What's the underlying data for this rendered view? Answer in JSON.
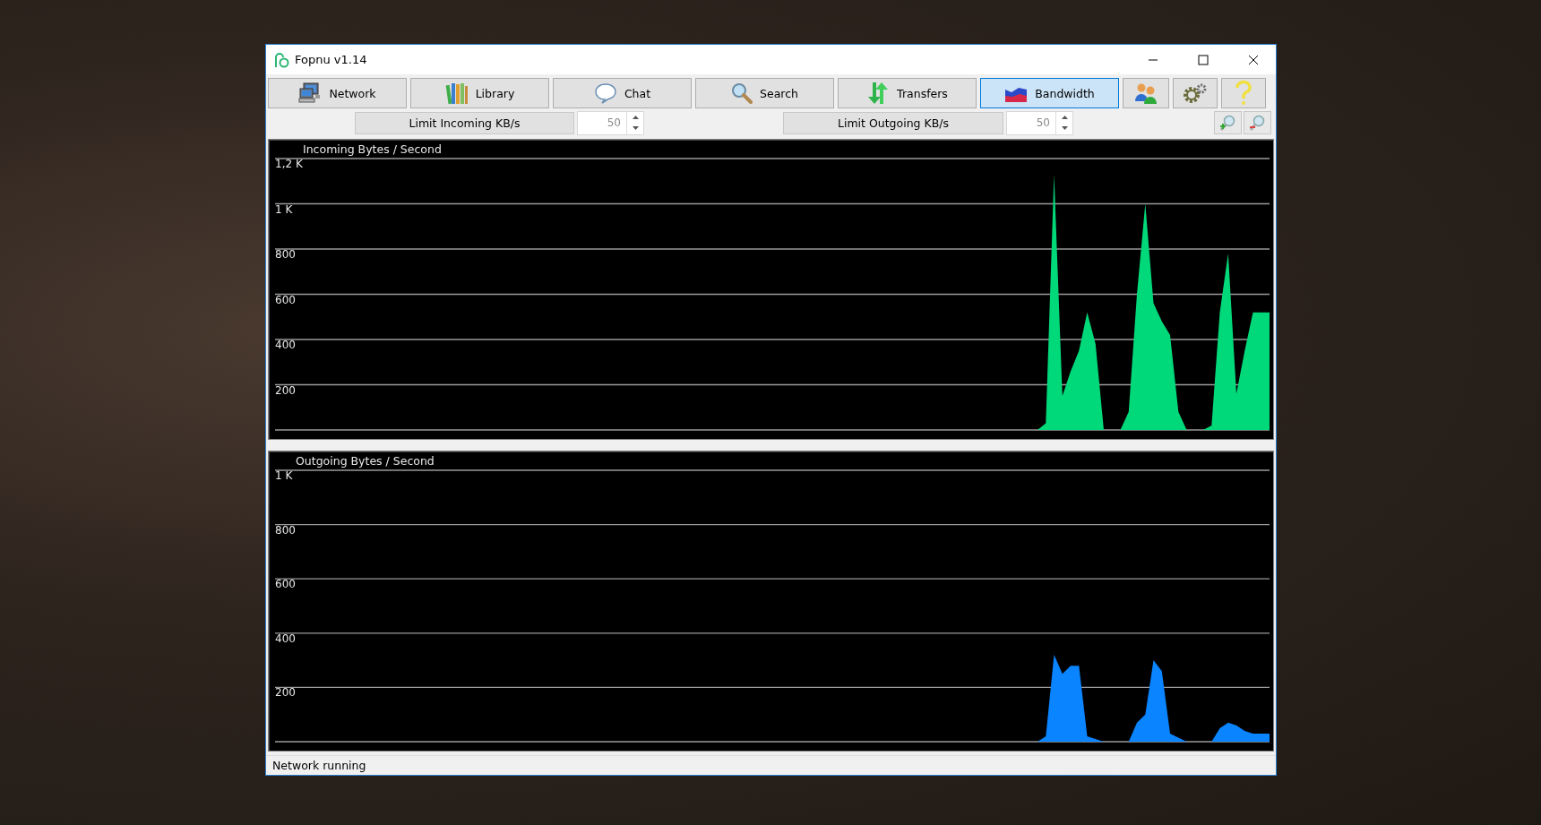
{
  "window": {
    "title": "Fopnu v1.14"
  },
  "toolbar": {
    "tabs": [
      {
        "label": "Network",
        "selected": false
      },
      {
        "label": "Library",
        "selected": false
      },
      {
        "label": "Chat",
        "selected": false
      },
      {
        "label": "Search",
        "selected": false
      },
      {
        "label": "Transfers",
        "selected": false
      },
      {
        "label": "Bandwidth",
        "selected": true
      }
    ]
  },
  "limits": [
    {
      "label": "Limit Incoming KB/s",
      "value": "50"
    },
    {
      "label": "Limit Outgoing KB/s",
      "value": "50"
    }
  ],
  "charts": [
    {
      "chart_data": {
        "type": "area",
        "title": "Incoming Bytes / Second",
        "grid": true,
        "categories": [
          null,
          null,
          null,
          null,
          null,
          null,
          null,
          null,
          null,
          null,
          null,
          null,
          null,
          null,
          null,
          null,
          null,
          null,
          null,
          null,
          null,
          null,
          null,
          null,
          null,
          null,
          null,
          null,
          null,
          null,
          null,
          null,
          null,
          null,
          null,
          null,
          null,
          null,
          null,
          null,
          null,
          null,
          null,
          null,
          null,
          null,
          null,
          null,
          null,
          null,
          null,
          null,
          null,
          null,
          null,
          null,
          null,
          null,
          null,
          null,
          null,
          null,
          null,
          null,
          null,
          null,
          null,
          null,
          null,
          null,
          null,
          null,
          null,
          null,
          null,
          null,
          null,
          null,
          null,
          null,
          null,
          null,
          null,
          null,
          null,
          null,
          null,
          null,
          null,
          null,
          null,
          null,
          null,
          null,
          null,
          null,
          null,
          null,
          null,
          null,
          null,
          null,
          null,
          null,
          null,
          null,
          null,
          null,
          null,
          null,
          null,
          null,
          null,
          null,
          null,
          null,
          null,
          null,
          null,
          null,
          null
        ],
        "ylim": [
          0,
          1200
        ],
        "yticks": [
          {
            "value": 1200,
            "label": "1,2 K"
          },
          {
            "value": 1000,
            "label": "1 K"
          },
          {
            "value": 800,
            "label": "800"
          },
          {
            "value": 600,
            "label": "600"
          },
          {
            "value": 400,
            "label": "400"
          },
          {
            "value": 200,
            "label": "200"
          }
        ],
        "series": [
          {
            "color": "#00d97a",
            "values": [
              0,
              0,
              0,
              0,
              0,
              0,
              0,
              0,
              0,
              0,
              0,
              0,
              0,
              0,
              0,
              0,
              0,
              0,
              0,
              0,
              0,
              0,
              0,
              0,
              0,
              0,
              0,
              0,
              0,
              0,
              0,
              0,
              0,
              0,
              0,
              0,
              0,
              0,
              0,
              0,
              0,
              0,
              0,
              0,
              0,
              0,
              0,
              0,
              0,
              0,
              0,
              0,
              0,
              0,
              0,
              0,
              0,
              0,
              0,
              0,
              0,
              0,
              0,
              0,
              0,
              0,
              0,
              0,
              0,
              0,
              0,
              0,
              0,
              0,
              0,
              0,
              0,
              0,
              0,
              0,
              0,
              0,
              0,
              0,
              0,
              0,
              0,
              0,
              0,
              0,
              0,
              0,
              0,
              30,
              1130,
              150,
              260,
              350,
              520,
              380,
              0,
              0,
              0,
              80,
              600,
              1000,
              560,
              480,
              420,
              80,
              0,
              0,
              0,
              20,
              520,
              780,
              160,
              350,
              520,
              520,
              520
            ]
          }
        ]
      }
    },
    {
      "chart_data": {
        "type": "area",
        "title": "Outgoing Bytes / Second",
        "grid": true,
        "categories": [
          null,
          null,
          null,
          null,
          null,
          null,
          null,
          null,
          null,
          null,
          null,
          null,
          null,
          null,
          null,
          null,
          null,
          null,
          null,
          null,
          null,
          null,
          null,
          null,
          null,
          null,
          null,
          null,
          null,
          null,
          null,
          null,
          null,
          null,
          null,
          null,
          null,
          null,
          null,
          null,
          null,
          null,
          null,
          null,
          null,
          null,
          null,
          null,
          null,
          null,
          null,
          null,
          null,
          null,
          null,
          null,
          null,
          null,
          null,
          null,
          null,
          null,
          null,
          null,
          null,
          null,
          null,
          null,
          null,
          null,
          null,
          null,
          null,
          null,
          null,
          null,
          null,
          null,
          null,
          null,
          null,
          null,
          null,
          null,
          null,
          null,
          null,
          null,
          null,
          null,
          null,
          null,
          null,
          null,
          null,
          null,
          null,
          null,
          null,
          null,
          null,
          null,
          null,
          null,
          null,
          null,
          null,
          null,
          null,
          null,
          null,
          null,
          null,
          null,
          null,
          null,
          null,
          null,
          null,
          null,
          null
        ],
        "ylim": [
          0,
          1000
        ],
        "yticks": [
          {
            "value": 1000,
            "label": "1 K"
          },
          {
            "value": 800,
            "label": "800"
          },
          {
            "value": 600,
            "label": "600"
          },
          {
            "value": 400,
            "label": "400"
          },
          {
            "value": 200,
            "label": "200"
          }
        ],
        "series": [
          {
            "color": "#0a84ff",
            "values": [
              0,
              0,
              0,
              0,
              0,
              0,
              0,
              0,
              0,
              0,
              0,
              0,
              0,
              0,
              0,
              0,
              0,
              0,
              0,
              0,
              0,
              0,
              0,
              0,
              0,
              0,
              0,
              0,
              0,
              0,
              0,
              0,
              0,
              0,
              0,
              0,
              0,
              0,
              0,
              0,
              0,
              0,
              0,
              0,
              0,
              0,
              0,
              0,
              0,
              0,
              0,
              0,
              0,
              0,
              0,
              0,
              0,
              0,
              0,
              0,
              0,
              0,
              0,
              0,
              0,
              0,
              0,
              0,
              0,
              0,
              0,
              0,
              0,
              0,
              0,
              0,
              0,
              0,
              0,
              0,
              0,
              0,
              0,
              0,
              0,
              0,
              0,
              0,
              0,
              0,
              0,
              0,
              0,
              20,
              320,
              250,
              280,
              280,
              20,
              10,
              0,
              0,
              0,
              0,
              70,
              100,
              300,
              260,
              30,
              15,
              0,
              0,
              0,
              0,
              50,
              70,
              60,
              40,
              30,
              30,
              30
            ]
          }
        ]
      }
    }
  ],
  "status_bar": {
    "text": "Network running"
  }
}
